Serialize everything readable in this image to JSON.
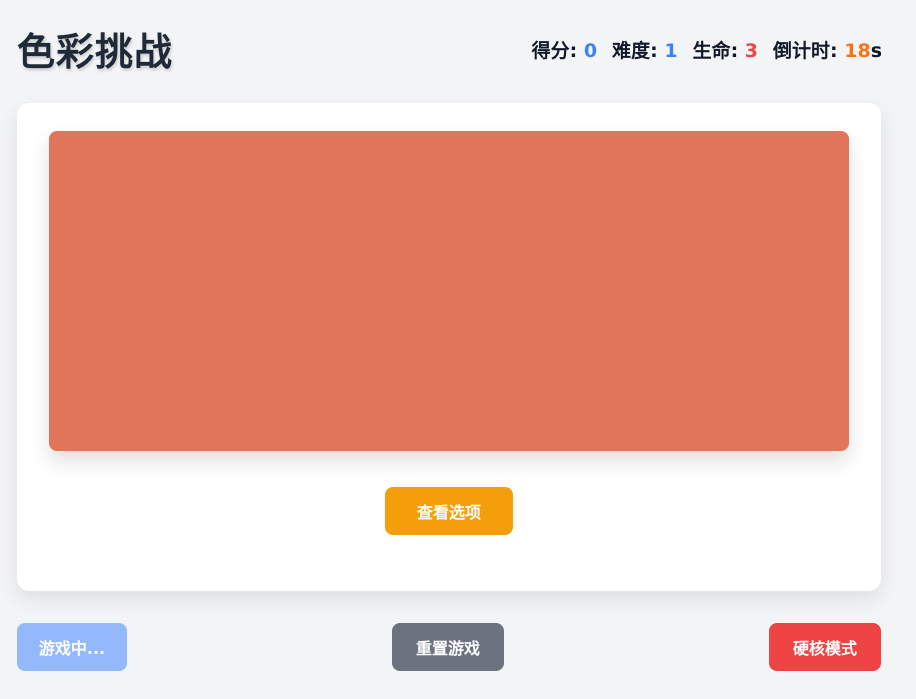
{
  "title": "色彩挑战",
  "stats": {
    "score_label": "得分: ",
    "score": "0",
    "difficulty_label": "难度: ",
    "difficulty": "1",
    "lives_label": "生命: ",
    "lives": "3",
    "countdown_label": "倒计时: ",
    "countdown": "18",
    "countdown_unit": "s"
  },
  "swatch_color": "#e07559",
  "buttons": {
    "view_options": "查看选项",
    "playing": "游戏中...",
    "reset": "重置游戏",
    "hardcore": "硬核模式"
  },
  "colors": {
    "score": "#3b82f6",
    "difficulty": "#3b82f6",
    "lives": "#ef4444",
    "countdown": "#f97316",
    "view_button": "#f59e0b",
    "playing_button": "#93b8fb",
    "reset_button": "#6b7280",
    "hardcore_button": "#ef4444"
  }
}
